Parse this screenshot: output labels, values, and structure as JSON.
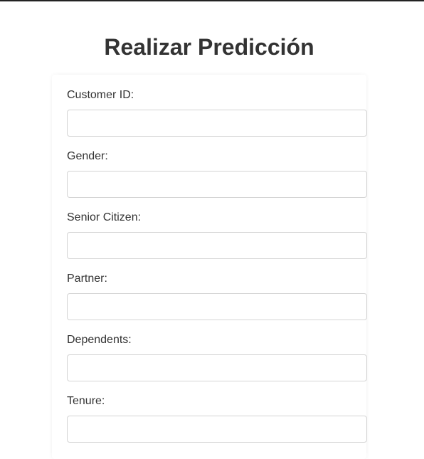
{
  "page": {
    "title": "Realizar Predicción"
  },
  "form": {
    "fields": [
      {
        "label": "Customer ID:",
        "value": "",
        "placeholder": ""
      },
      {
        "label": "Gender:",
        "value": "",
        "placeholder": ""
      },
      {
        "label": "Senior Citizen:",
        "value": "",
        "placeholder": ""
      },
      {
        "label": "Partner:",
        "value": "",
        "placeholder": ""
      },
      {
        "label": "Dependents:",
        "value": "",
        "placeholder": ""
      },
      {
        "label": "Tenure:",
        "value": "",
        "placeholder": ""
      }
    ]
  }
}
